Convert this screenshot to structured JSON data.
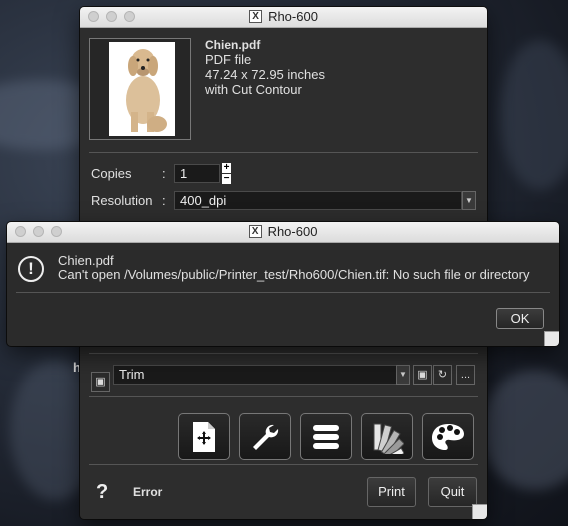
{
  "main_window": {
    "title": "Rho-600",
    "file": {
      "name": "Chien.pdf",
      "type": "PDF file",
      "size": "47.24 x 72.95 inches",
      "note": "with Cut Contour"
    },
    "copies_label": "Copies",
    "copies_value": "1",
    "resolution_label": "Resolution",
    "resolution_value": "400_dpi",
    "colon": ":",
    "trim_value": "Trim",
    "more_label": "...",
    "help_label": "?",
    "status_text": "Error",
    "print_label": "Print",
    "quit_label": "Quit",
    "tools": [
      {
        "name": "layout-document-icon"
      },
      {
        "name": "wrench-icon"
      },
      {
        "name": "queue-list-icon"
      },
      {
        "name": "color-swatches-icon"
      },
      {
        "name": "palette-icon"
      }
    ]
  },
  "error_dialog": {
    "title": "Rho-600",
    "heading": "Chien.pdf",
    "message": "Can't open /Volumes/public/Printer_test/Rho600/Chien.tif: No such file or directory",
    "ok_label": "OK"
  },
  "desktop": {
    "partial_text": "h"
  }
}
